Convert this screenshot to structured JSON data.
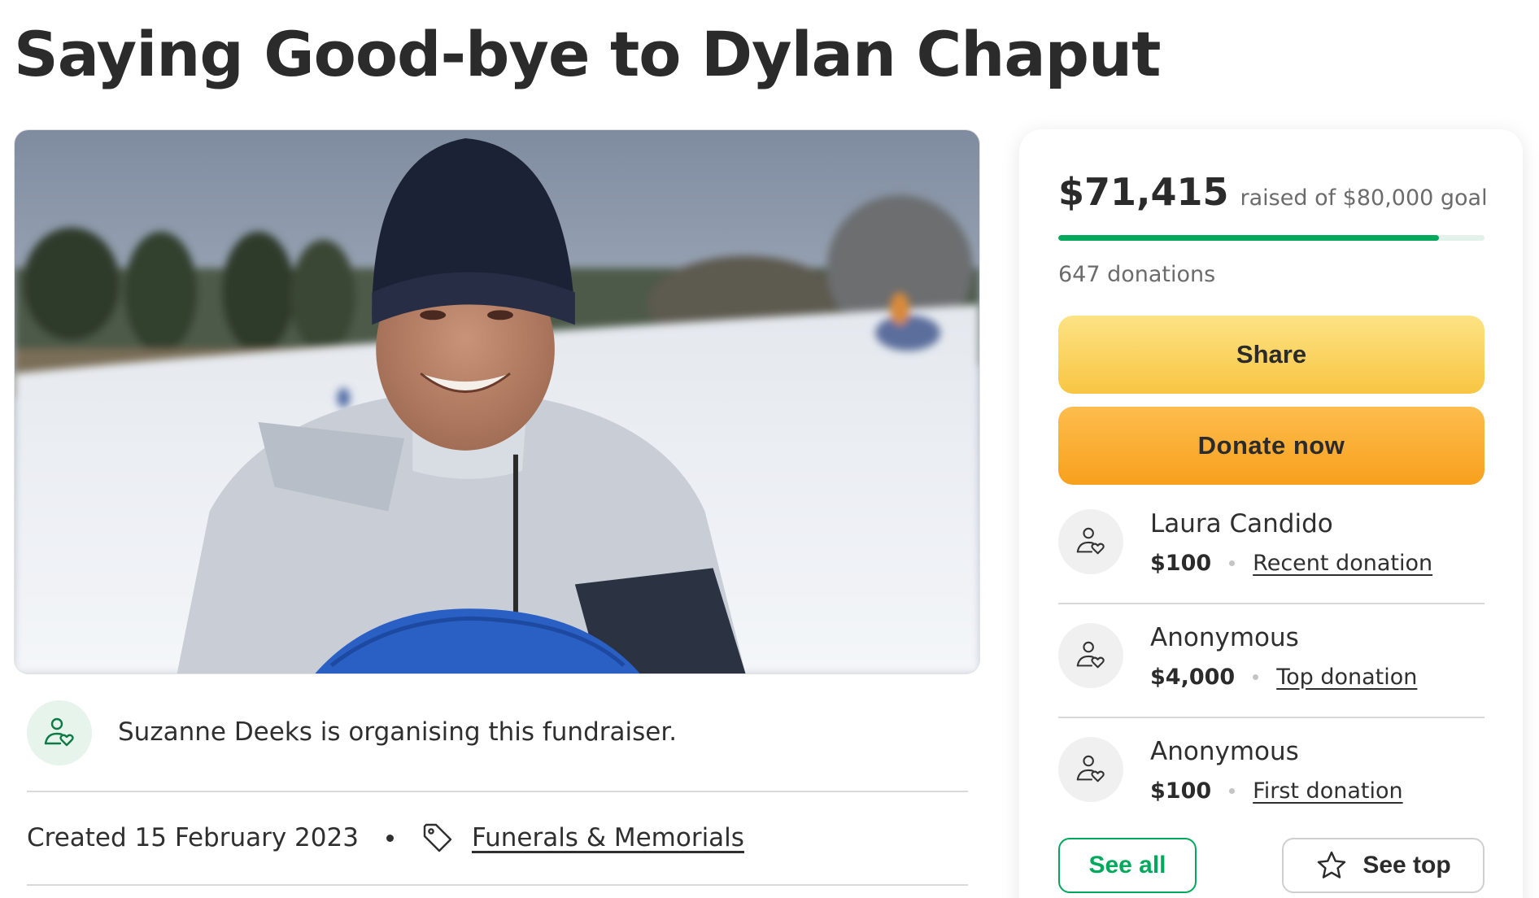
{
  "page": {
    "title": "Saying Good-bye to Dylan Chaput"
  },
  "organiser": {
    "text": "Suzanne Deeks is organising this fundraiser.",
    "icon": "person-heart-icon"
  },
  "meta": {
    "created": "Created 15 February 2023",
    "category": "Funerals & Memorials",
    "category_icon": "tag-icon"
  },
  "card": {
    "raised_amount": "$71,415",
    "goal_text": "raised of $80,000 goal",
    "progress_fraction": 0.8927,
    "donations_count": "647 donations",
    "share_label": "Share",
    "donate_label": "Donate now",
    "donors": [
      {
        "name": "Laura Candido",
        "amount": "$100",
        "type": "Recent donation",
        "icon": "person-heart-icon"
      },
      {
        "name": "Anonymous",
        "amount": "$4,000",
        "type": "Top donation",
        "icon": "person-heart-icon"
      },
      {
        "name": "Anonymous",
        "amount": "$100",
        "type": "First donation",
        "icon": "person-heart-icon"
      }
    ],
    "see_all_label": "See all",
    "see_top_label": "See top",
    "see_top_icon": "star-icon"
  },
  "colors": {
    "brand_green": "#02a95c",
    "share_yellow": "#f8c542",
    "donate_orange": "#f8a01d"
  }
}
